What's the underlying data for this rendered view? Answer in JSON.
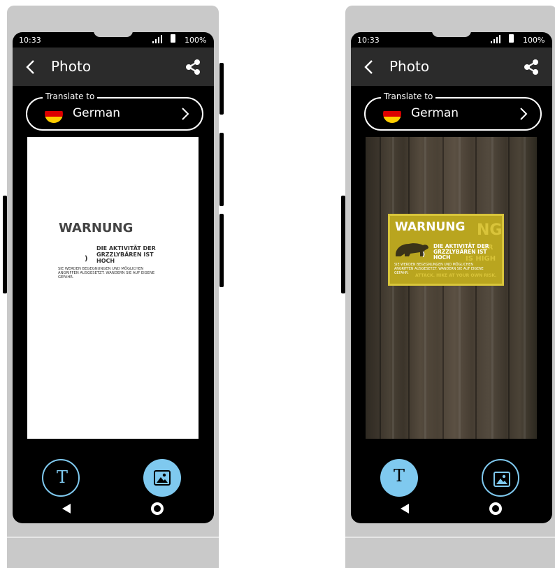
{
  "status": {
    "time": "10:33",
    "battery": "100%"
  },
  "header": {
    "title": "Photo",
    "back_icon": "chevron-left-icon",
    "share_icon": "share-icon"
  },
  "translate": {
    "legend": "Translate to",
    "language": "German",
    "flag_colors": [
      "#000000",
      "#dd0000",
      "#ffce00"
    ]
  },
  "translation": {
    "heading": "WARNUNG",
    "activity_text": "DIE AKTIVITÄT DER GRZZLYBÄREN IST HOCH",
    "activity_lines": [
      "DIE AKTIVITÄT DER",
      "GRZZLYBÄREN IST",
      "HOCH"
    ],
    "bullet": ")",
    "notice_lines": [
      "SIE WERDEN BEGEGNUNGEN UND MÖGLICHEN",
      "ANGRIFFEN AUSGESETZT. WANDERN SIE AUF EIGENE",
      "GEFAHR."
    ]
  },
  "photo_sign": {
    "ghost_heading_tail": "NG",
    "ghost_right": [
      "AR",
      "IS HIGH"
    ],
    "ghost_bottom": "ATTACK. HIKE AT YOUR OWN RISK."
  },
  "buttons": {
    "text_mode_label": "T",
    "image_mode_icon": "image-icon"
  },
  "nav": {
    "back_icon": "triangle-back-icon",
    "home_icon": "home-circle-icon"
  },
  "colors": {
    "accent": "#7fc9ef",
    "header_bg": "#2b2b2b",
    "screen_bg": "#000000"
  }
}
